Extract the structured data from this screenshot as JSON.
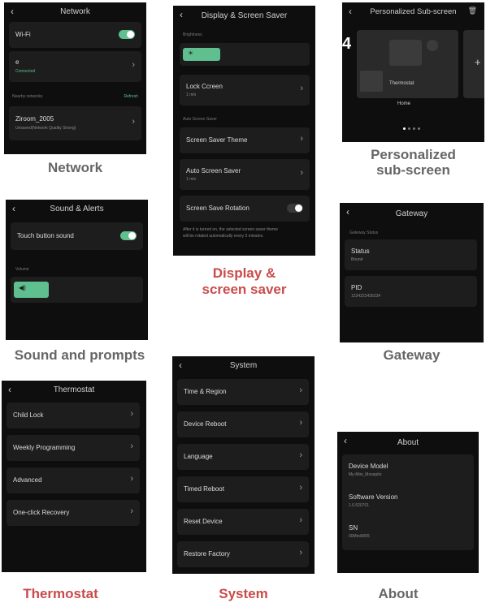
{
  "colors": {
    "accent": "#5fbf8f",
    "caption_gray": "#666666",
    "caption_red": "#c94b4b"
  },
  "network": {
    "title": "Network",
    "wifi_label": "Wi-Fi",
    "wifi_on": true,
    "connected_name": "e",
    "connected_status": "Connected",
    "nearby_label": "Nearby networks",
    "refresh_label": "Refresh",
    "network_name": "Ziroom_2005",
    "network_status": "Unsaved(Network Quality Strong)",
    "caption": "Network"
  },
  "display": {
    "title": "Display & Screen Saver",
    "brightness_label": "Brightness",
    "brightness_level": 0.3,
    "lock_label": "Lock Ccreen",
    "lock_value": "1 min",
    "auto_section_label": "Auto Screen Saver",
    "theme_label": "Screen Saver Theme",
    "auto_label": "Auto Screen Saver",
    "auto_value": "1 min",
    "rotation_label": "Screen Save Rotation",
    "rotation_on": false,
    "rotation_note_line1": "After it is turned on, the selected screen saver theme",
    "rotation_note_line2": "will be rotated automatically every 3 minutes.",
    "caption_line1": "Display &",
    "caption_line2": "screen saver"
  },
  "personalized": {
    "title": "Personalized Sub-screen",
    "left_edge_digit": "4",
    "widget_label": "Thermostat",
    "home_label": "Home",
    "add_symbol": "+",
    "caption_line1": "Personalized",
    "caption_line2": "sub-screen"
  },
  "sound": {
    "title": "Sound & Alerts",
    "touch_label": "Touch button sound",
    "touch_on": true,
    "volume_label": "Volume",
    "volume_level": 0.28,
    "caption": "Sound and prompts"
  },
  "gateway": {
    "title": "Gateway",
    "section_label": "Gateway Status",
    "status_label": "Status",
    "status_value": "Bound",
    "pid_label": "PID",
    "pid_value": "1234223435234",
    "caption": "Gateway"
  },
  "thermostat": {
    "title": "Thermostat",
    "items": [
      "Child Lock",
      "Weekly Programming",
      "Advanced",
      "One-click Recovery"
    ],
    "caption": "Thermostat"
  },
  "system": {
    "title": "System",
    "items": [
      "Time & Region",
      "Device Reboot",
      "Language",
      "Timed Reboot",
      "Reset Device",
      "Restore Factory"
    ],
    "caption": "System"
  },
  "about": {
    "title": "About",
    "model_label": "Device Model",
    "model_value": "My-Mini_Mosquito",
    "software_label": "Software Version",
    "software_value": "1.0.520701",
    "sn_label": "SN",
    "sn_value": "00Mini0005",
    "caption": "About"
  }
}
